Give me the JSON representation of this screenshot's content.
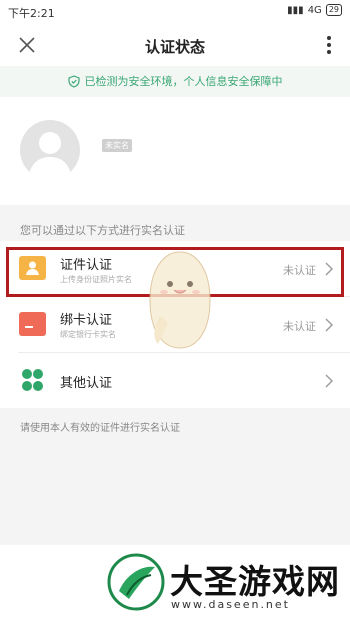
{
  "status_bar": {
    "time": "下午2:21",
    "network": "4G",
    "battery": "29"
  },
  "nav": {
    "title": "认证状态"
  },
  "safety_banner": {
    "text": "已检测为安全环境，个人信息安全保障中"
  },
  "profile": {
    "badge": "未实名"
  },
  "section_hint": "您可以通过以下方式进行实名认证",
  "methods": [
    {
      "title": "证件认证",
      "subtitle": "上传身份证照片实名",
      "status": "未认证",
      "icon": "id-card-icon",
      "color": "#f6b447"
    },
    {
      "title": "绑卡认证",
      "subtitle": "绑定银行卡实名",
      "status": "未认证",
      "icon": "bank-card-icon",
      "color": "#ef6a57"
    },
    {
      "title": "其他认证",
      "subtitle": "",
      "status": "",
      "icon": "grid-dots-icon",
      "color": "#2fa66a"
    }
  ],
  "footer_hint": "请使用本人有效的证件进行实名认证",
  "watermark": {
    "title": "大圣游戏网",
    "url": "www.daseen.net"
  },
  "colors": {
    "accent_green": "#3aa774",
    "highlight_red": "#b21c1c"
  }
}
